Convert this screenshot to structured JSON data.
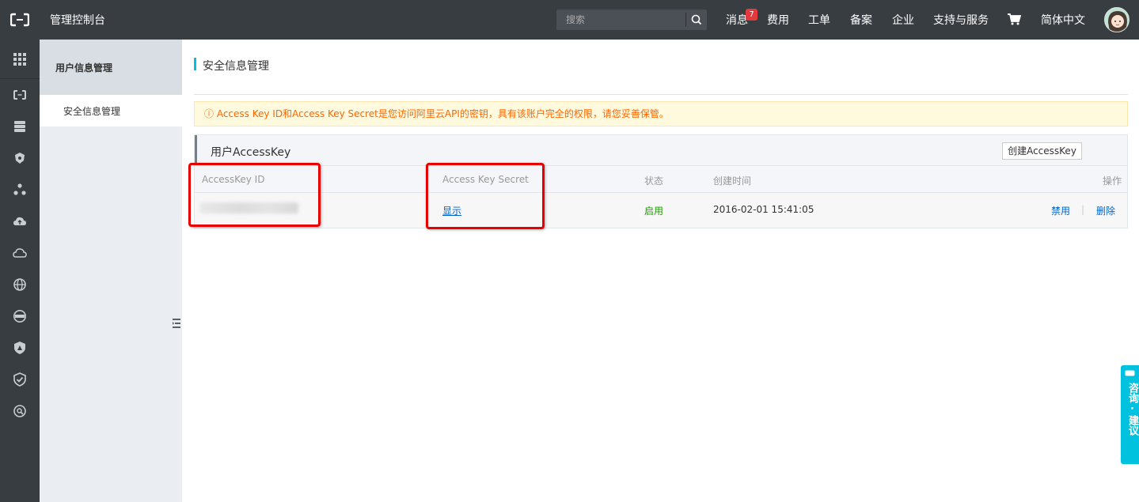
{
  "topbar": {
    "title": "管理控制台",
    "search_placeholder": "搜索",
    "nav": [
      "消息",
      "费用",
      "工单",
      "备案",
      "企业",
      "支持与服务"
    ],
    "message_badge": "7",
    "language": "简体中文"
  },
  "sidebar": {
    "section_title": "用户信息管理",
    "items": [
      {
        "label": "安全信息管理",
        "active": true
      }
    ]
  },
  "main": {
    "page_title": "安全信息管理",
    "notice": "ⓘ Access Key ID和Access Key Secret是您访问阿里云API的密钥，具有该账户完全的权限，请您妥善保管。",
    "panel_title": "用户AccessKey",
    "create_button": "创建AccessKey",
    "table": {
      "headers": [
        "AccessKey ID",
        "Access Key Secret",
        "状态",
        "创建时间",
        "操作"
      ],
      "rows": [
        {
          "secret_link": "显示",
          "status": "启用",
          "created": "2016-02-01 15:41:05",
          "actions": [
            "禁用",
            "删除"
          ]
        }
      ]
    }
  },
  "feedback_tab": "咨询·建议",
  "colors": {
    "topbar": "#373d41",
    "accent": "#00c1de",
    "highlight": "#e60000",
    "notice_text": "#ff6600",
    "status_on": "#1e9f00",
    "link": "#0066cc"
  },
  "icons": [
    "grid-icon",
    "brand-icon",
    "server-icon",
    "shield-bug-icon",
    "cluster-icon",
    "cloud-upload-icon",
    "cloud-icon",
    "globe-icon",
    "dns-icon",
    "security-icon",
    "shield-check-icon",
    "search-doc-icon",
    "cart-icon",
    "search-icon",
    "sidebar-collapse-icon"
  ]
}
